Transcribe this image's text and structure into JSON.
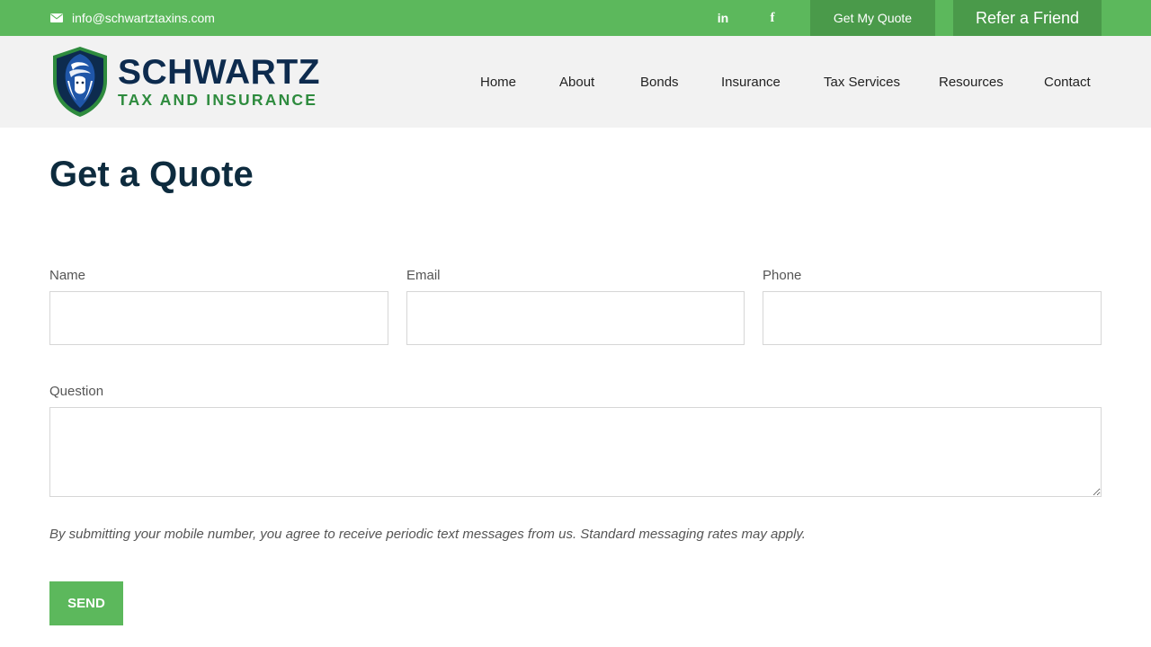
{
  "topbar": {
    "email": "info@schwartztaxins.com",
    "social": {
      "linkedin": "in",
      "facebook": "f"
    },
    "quote_button": "Get My Quote",
    "refer_button": "Refer a Friend"
  },
  "logo": {
    "brand": "SCHWARTZ",
    "tagline": "TAX AND INSURANCE"
  },
  "nav": {
    "items": [
      "Home",
      "About",
      "Bonds",
      "Insurance",
      "Tax Services",
      "Resources",
      "Contact"
    ]
  },
  "page": {
    "title": "Get a Quote"
  },
  "form": {
    "name_label": "Name",
    "email_label": "Email",
    "phone_label": "Phone",
    "question_label": "Question",
    "notice": "By submitting your mobile number, you agree to receive periodic text messages from us. Standard messaging rates may apply.",
    "send_label": "SEND"
  },
  "colors": {
    "accent_green": "#5cb85c",
    "dark_green": "#4a9a4a",
    "navy": "#0d2b4e",
    "brand_green": "#2e8b3e"
  }
}
